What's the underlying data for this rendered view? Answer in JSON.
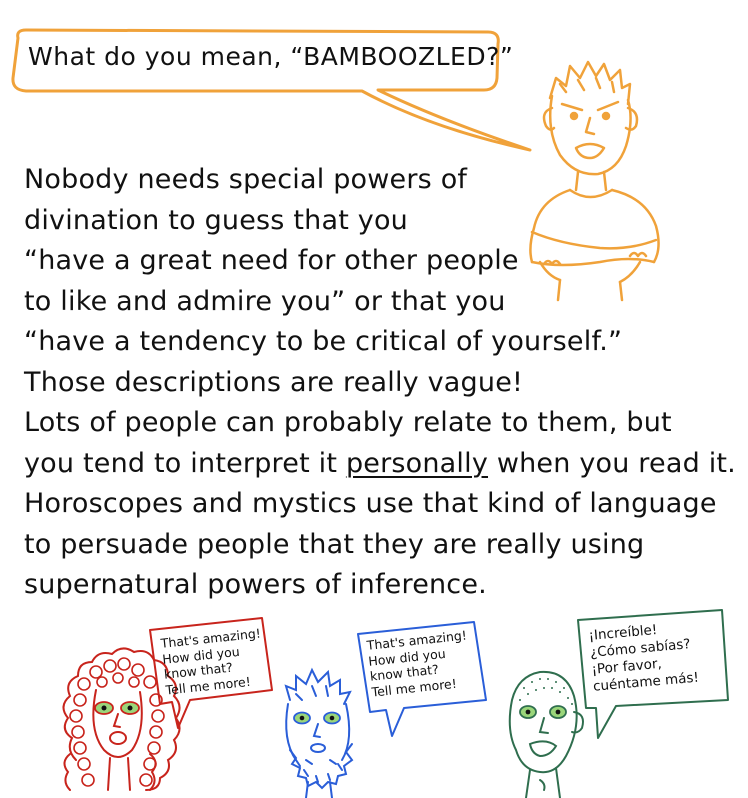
{
  "top_speech": "What do you mean, “BAMBOOZLED?”",
  "narration_lines": [
    "Nobody needs special powers of",
    "divination to guess that you",
    "“have a great need for other people",
    "to like and admire you” or that you",
    "“have a tendency to be critical of yourself.”",
    "Those descriptions are really vague!",
    "Lots of people can probably relate to them, but",
    "you tend to interpret it",
    "personally",
    "when you read it.",
    "Horoscopes and mystics use that kind of language",
    "to persuade people that they are really using",
    "supernatural powers of inference."
  ],
  "bubble_red": [
    "That's amazing!",
    "How did you",
    "know that?",
    "Tell me more!"
  ],
  "bubble_blue": [
    "That's amazing!",
    "How did you",
    "know that?",
    "Tell me more!"
  ],
  "bubble_green": [
    "¡Increíble!",
    "¿Cómo sabías?",
    "¡Por favor,",
    "cuéntame más!"
  ],
  "colors": {
    "orange": "#f0a23a",
    "red": "#c8241c",
    "blue": "#2a5ed8",
    "green": "#2f6e4e",
    "eye_green": "#9ad67a",
    "ink": "#111111"
  }
}
